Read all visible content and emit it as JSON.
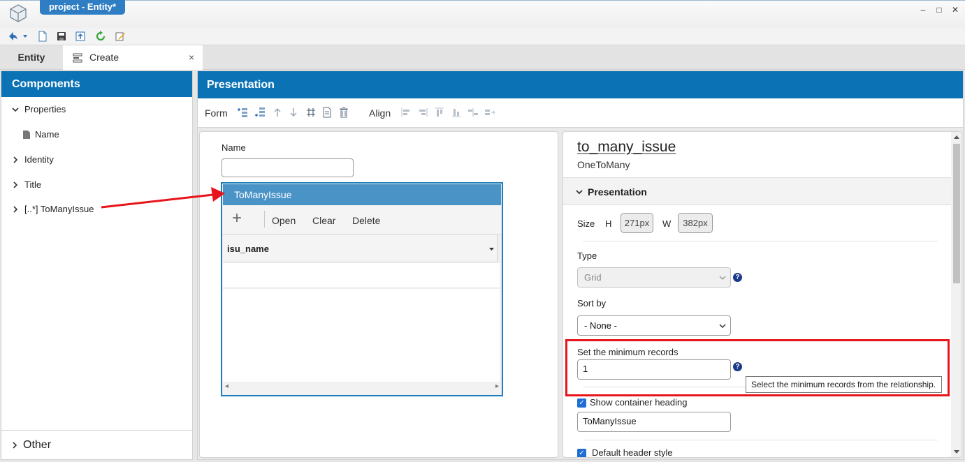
{
  "window": {
    "title": "project - Entity*",
    "minimize": "–",
    "maximize": "□",
    "close": "✕"
  },
  "tabs": {
    "entity": "Entity",
    "create": "Create",
    "close": "×"
  },
  "components": {
    "heading": "Components",
    "tree": [
      {
        "label": "Properties"
      },
      {
        "label": "Name"
      },
      {
        "label": "Identity"
      },
      {
        "label": "Title"
      },
      {
        "label": "[..*] ToManyIssue"
      }
    ],
    "other": "Other"
  },
  "presentation": {
    "heading": "Presentation",
    "form_label": "Form",
    "align_label": "Align"
  },
  "canvas": {
    "name_label": "Name",
    "name_value": "",
    "grid_title": "ToManyIssue",
    "btn_add": "+",
    "btn_open": "Open",
    "btn_clear": "Clear",
    "btn_delete": "Delete",
    "column_header": "isu_name",
    "scroll_left": "◂",
    "scroll_right": "▸"
  },
  "properties": {
    "name": "to_many_issue",
    "kind": "OneToMany",
    "section": "Presentation",
    "size_label": "Size",
    "h_label": "H",
    "h_value": "271px",
    "w_label": "W",
    "w_value": "382px",
    "type_label": "Type",
    "type_value": "Grid",
    "sortby_label": "Sort by",
    "sortby_value": "- None -",
    "min_records_label": "Set the minimum records",
    "min_records_value": "1",
    "tooltip": "Select the minimum records from the relationship.",
    "show_heading_label": "Show container heading",
    "heading_value": "ToManyIssue",
    "default_header_label": "Default header style",
    "help": "?"
  },
  "colors": {
    "brand": "#0b72b5",
    "title_tab": "#2f7ec4",
    "annotation": "#e8141b"
  }
}
